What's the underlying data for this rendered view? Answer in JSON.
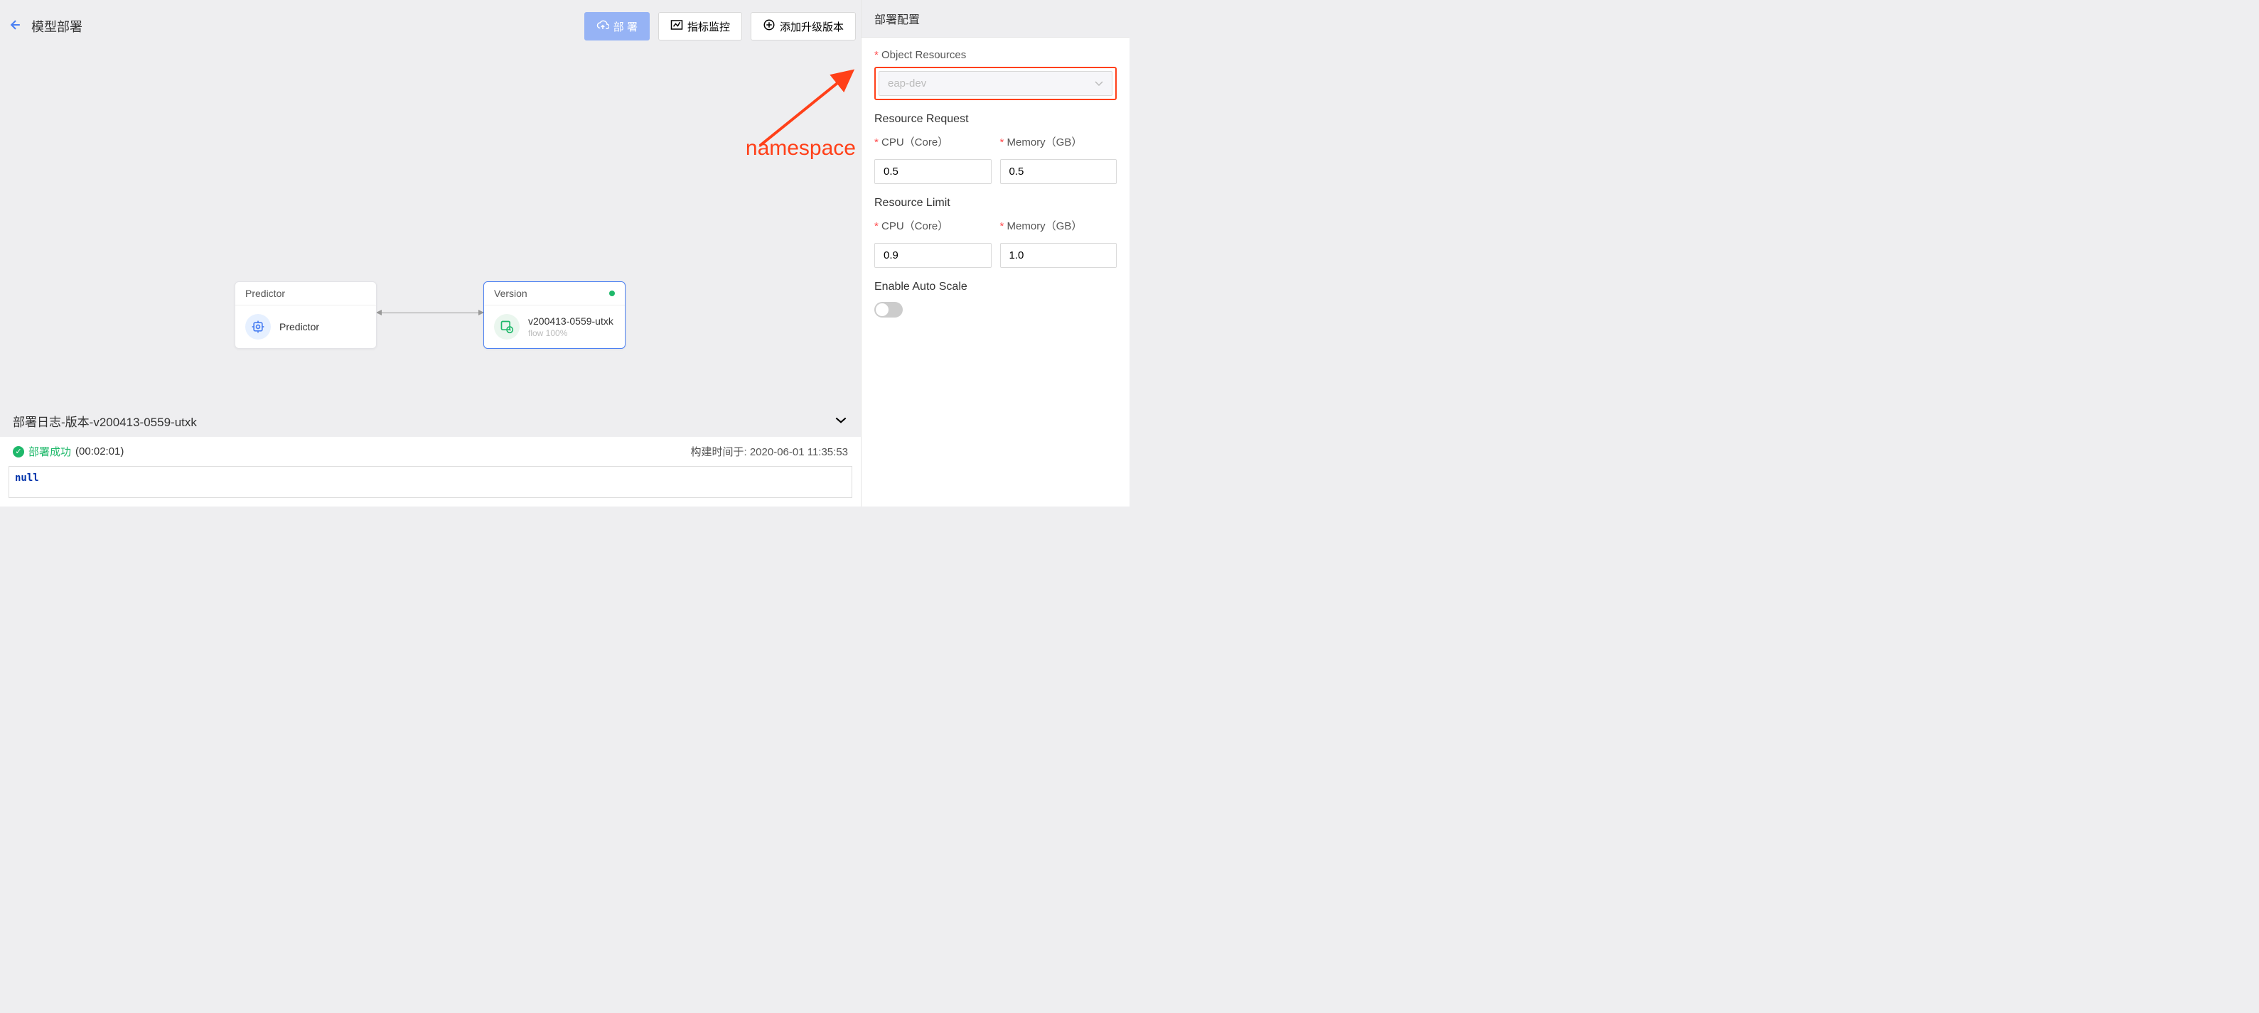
{
  "header": {
    "title": "模型部署",
    "btn_deploy": "部 署",
    "btn_metrics": "指标监控",
    "btn_add_version": "添加升级版本"
  },
  "canvas": {
    "predictor_node": {
      "header": "Predictor",
      "title": "Predictor"
    },
    "version_node": {
      "header": "Version",
      "title": "v200413-0559-utxk",
      "subtitle": "flow 100%"
    }
  },
  "log": {
    "header": "部署日志-版本-v200413-0559-utxk",
    "status_text": "部署成功",
    "duration": "(00:02:01)",
    "build_prefix": "构建时间于: ",
    "build_time": "2020-06-01 11:35:53",
    "output": "null"
  },
  "panel": {
    "title": "部署配置",
    "object_resources_label": "Object Resources",
    "object_resources_value": "eap-dev",
    "resource_request_title": "Resource Request",
    "cpu_label": "CPU（Core）",
    "memory_label": "Memory（GB）",
    "request_cpu": "0.5",
    "request_memory": "0.5",
    "resource_limit_title": "Resource Limit",
    "limit_cpu": "0.9",
    "limit_memory": "1.0",
    "auto_scale_label": "Enable Auto Scale"
  },
  "annotation": {
    "text": "namespace"
  }
}
